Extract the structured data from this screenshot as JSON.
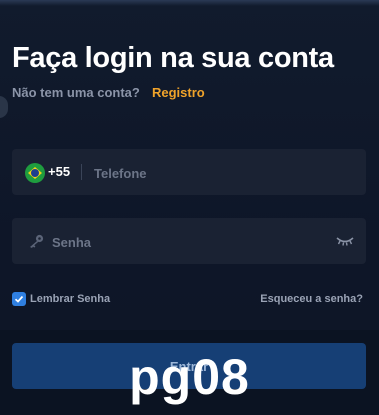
{
  "header": {
    "title": "Faça login na sua conta",
    "subtitle": "Não tem uma conta?",
    "register_label": "Registro"
  },
  "phone_field": {
    "country_flag_icon": "brazil-flag-icon",
    "dial_code": "+55",
    "placeholder": "Telefone",
    "value": ""
  },
  "password_field": {
    "leading_icon": "key-icon",
    "placeholder": "Senha",
    "value": "",
    "toggle_icon": "eye-closed-icon"
  },
  "options": {
    "remember_label": "Lembrar Senha",
    "remember_checked": true,
    "forgot_label": "Esqueceu a senha?"
  },
  "submit": {
    "label": "Entrar"
  },
  "watermark": {
    "text": "pg08"
  },
  "colors": {
    "background": "#111b2d",
    "field": "#1a2233",
    "accent": "#f0a32a",
    "checkbox": "#2f7fe0",
    "button": "#163f75"
  }
}
